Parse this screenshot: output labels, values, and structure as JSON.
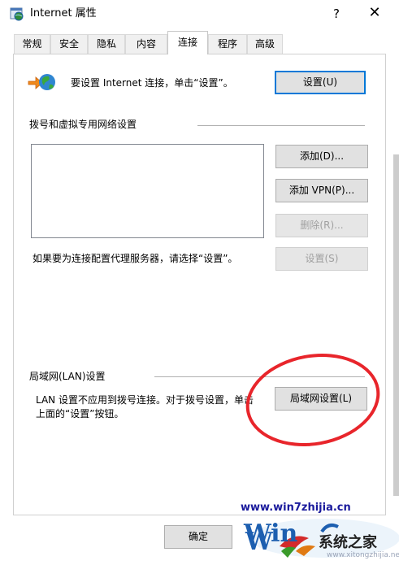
{
  "window": {
    "title": "Internet 属性",
    "help_label": "?",
    "close_label": "✕"
  },
  "tabs": [
    {
      "label": "常规"
    },
    {
      "label": "安全"
    },
    {
      "label": "隐私"
    },
    {
      "label": "内容"
    },
    {
      "label": "连接"
    },
    {
      "label": "程序"
    },
    {
      "label": "高级"
    }
  ],
  "active_tab": "连接",
  "setup": {
    "text": "要设置 Internet 连接，单击“设置”。",
    "button": "设置(U)"
  },
  "dialup": {
    "heading": "拨号和虚拟专用网络设置",
    "add_button": "添加(D)...",
    "add_vpn_button": "添加 VPN(P)...",
    "remove_button": "删除(R)...",
    "proxy_text": "如果要为连接配置代理服务器，请选择“设置”。",
    "settings_button": "设置(S)"
  },
  "lan": {
    "heading": "局域网(LAN)设置",
    "text_line1": "LAN 设置不应用到拨号连接。对于拨号设置，单击",
    "text_line2": "上面的“设置”按钮。",
    "button": "局域网设置(L)"
  },
  "footer": {
    "ok_button": "确定"
  },
  "watermark": {
    "url": "www.win7zhijia.cn",
    "logo_text": "Win",
    "brand": "系统之家",
    "sub": "www.xitongzhijia.net"
  },
  "colors": {
    "accent": "#0078d7",
    "annotation": "#e8252b"
  }
}
